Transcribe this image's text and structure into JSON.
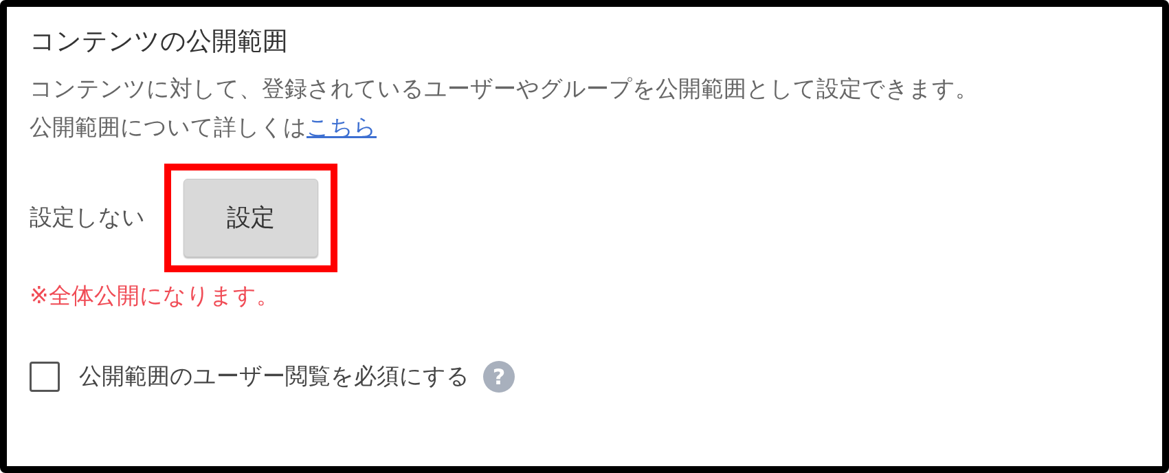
{
  "section": {
    "title": "コンテンツの公開範囲",
    "description": "コンテンツに対して、登録されているユーザーやグループを公開範囲として設定できます。",
    "help_line": {
      "text": "公開範囲について詳しくは",
      "link": "こちら"
    }
  },
  "scope": {
    "status": "設定しない",
    "button": {
      "label": "設定",
      "highlighted": true
    },
    "note": "※全体公開になります。"
  },
  "required_view": {
    "label": "公開範囲のユーザー閲覧を必須にする",
    "checked": false,
    "help": "?"
  }
}
